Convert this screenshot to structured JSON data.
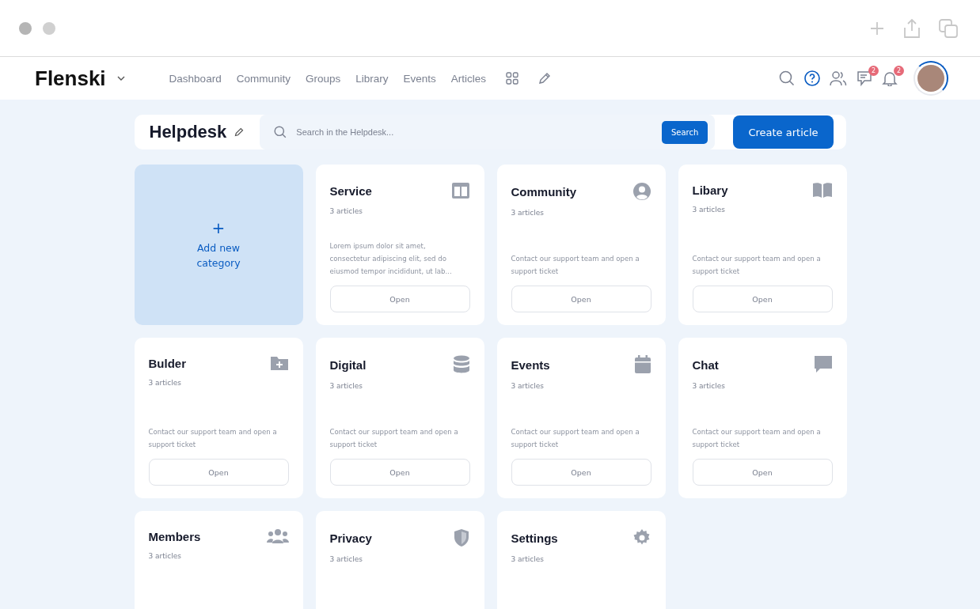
{
  "brand": {
    "name": "Flenski"
  },
  "nav": [
    {
      "label": "Dashboard"
    },
    {
      "label": "Community"
    },
    {
      "label": "Groups"
    },
    {
      "label": "Library"
    },
    {
      "label": "Events"
    },
    {
      "label": "Articles"
    }
  ],
  "badges": {
    "messages": "2",
    "notifications": "2"
  },
  "helpdesk": {
    "title": "Helpdesk",
    "search_placeholder": "Search in the Helpdesk...",
    "search_button": "Search",
    "create_button": "Create article"
  },
  "add_category": {
    "icon": "+",
    "label": "Add new category"
  },
  "categories": [
    {
      "title": "Service",
      "count": "3 articles",
      "kind": "columns",
      "text": "Lorem ipsum dolor sit amet, consectetur adipiscing elit, sed do eiusmod tempor incididunt, ut lab...",
      "button": "Open"
    },
    {
      "title": "Community",
      "count": "3 articles",
      "kind": "user",
      "text": "Contact our support team and open a support ticket",
      "button": "Open"
    },
    {
      "title": "Libary",
      "count": "3 articles",
      "kind": "book",
      "text": "Contact our support team and open a support ticket",
      "button": "Open"
    },
    {
      "title": "Bulder",
      "count": "3 articles",
      "kind": "folder",
      "text": "Contact our support team and open a support ticket",
      "button": "Open"
    },
    {
      "title": "Digital",
      "count": "3 articles",
      "kind": "database",
      "text": "Contact our support team and open a support ticket",
      "button": "Open"
    },
    {
      "title": "Events",
      "count": "3 articles",
      "kind": "calendar",
      "text": "Contact our support team and open a support ticket",
      "button": "Open"
    },
    {
      "title": "Chat",
      "count": "3 articles",
      "kind": "chat",
      "text": "Contact our support team and open a support ticket",
      "button": "Open"
    },
    {
      "title": "Members",
      "count": "3 articles",
      "kind": "users"
    },
    {
      "title": "Privacy",
      "count": "3 articles",
      "kind": "shield"
    },
    {
      "title": "Settings",
      "count": "3 articles",
      "kind": "gear"
    }
  ]
}
